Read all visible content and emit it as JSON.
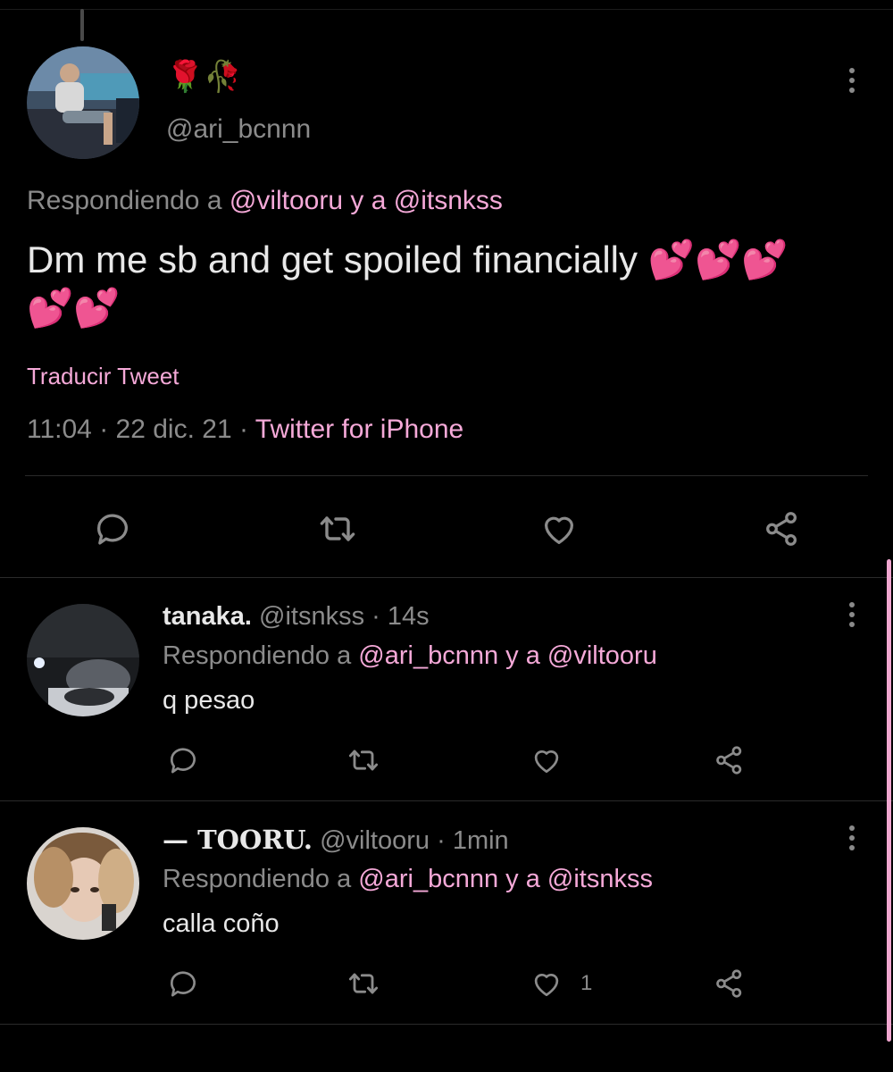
{
  "main_tweet": {
    "display_name": "🌹🥀",
    "handle": "@ari_bcnnn",
    "replying_prefix": "Respondiendo a",
    "replying_user1": "@viltooru",
    "replying_and": "y a",
    "replying_user2": "@itsnkss",
    "text_line1": "Dm me sb and get spoiled financially 💕💕💕",
    "text_line2": "💕💕",
    "translate": "Traducir Tweet",
    "time": "11:04",
    "date": "22 dic. 21",
    "source": "Twitter for iPhone",
    "separator": "·"
  },
  "replies": [
    {
      "name": "tanaka.",
      "handle": "@itsnkss",
      "age": "14s",
      "replying_prefix": "Respondiendo a",
      "replying_user1": "@ari_bcnnn",
      "replying_and": "y a",
      "replying_user2": "@viltooru",
      "text": "q pesao",
      "like_count": ""
    },
    {
      "name": "— TOORU.",
      "handle": "@viltooru",
      "age": "1min",
      "replying_prefix": "Respondiendo a",
      "replying_user1": "@ari_bcnnn",
      "replying_and": "y a",
      "replying_user2": "@itsnkss",
      "text": "calla coño",
      "like_count": "1"
    }
  ],
  "colors": {
    "background": "#000000",
    "accent_pink": "#f5a9d8",
    "muted_text": "#8b8b8b",
    "primary_text": "#e8e8e8"
  },
  "icons": [
    "reply-icon",
    "retweet-icon",
    "like-icon",
    "share-icon",
    "more-icon"
  ]
}
